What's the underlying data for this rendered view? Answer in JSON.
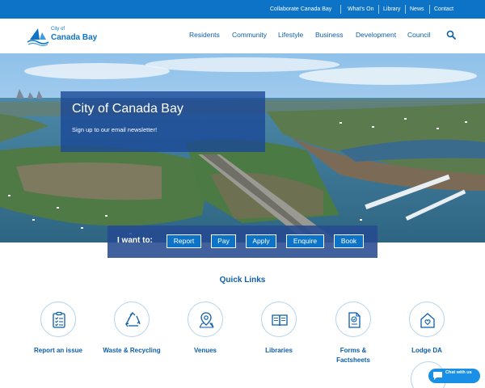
{
  "utility_nav": {
    "items": [
      {
        "label": "Collaborate Canada Bay"
      },
      {
        "label": "What's On"
      },
      {
        "label": "Library"
      },
      {
        "label": "News"
      },
      {
        "label": "Contact"
      }
    ]
  },
  "header": {
    "logo": {
      "line1": "City of",
      "line2": "Canada Bay",
      "icon": "boat-wave-logo-icon"
    },
    "nav": [
      {
        "label": "Residents"
      },
      {
        "label": "Community"
      },
      {
        "label": "Lifestyle"
      },
      {
        "label": "Business"
      },
      {
        "label": "Development"
      },
      {
        "label": "Council"
      }
    ],
    "search_icon": "search-icon"
  },
  "hero": {
    "title": "City of Canada Bay",
    "newsletter_link": "Sign up to our email newsletter!"
  },
  "want_to": {
    "label": "I want to:",
    "buttons": [
      {
        "label": "Report"
      },
      {
        "label": "Pay"
      },
      {
        "label": "Apply"
      },
      {
        "label": "Enquire"
      },
      {
        "label": "Book"
      }
    ]
  },
  "quick_links": {
    "heading": "Quick Links",
    "items": [
      {
        "label": "Report an issue",
        "icon": "clipboard-checklist-icon"
      },
      {
        "label": "Waste & Recycling",
        "icon": "recycle-icon"
      },
      {
        "label": "Venues",
        "icon": "map-pin-icon"
      },
      {
        "label": "Libraries",
        "icon": "open-book-icon"
      },
      {
        "label": "Forms & Factsheets",
        "icon": "form-document-icon"
      },
      {
        "label": "Lodge DA",
        "icon": "house-heart-icon"
      }
    ]
  },
  "chat": {
    "label": "Chat with us",
    "icon": "chat-bubble-icon"
  },
  "colors": {
    "brand_blue": "#0c73c7",
    "text_blue": "#0d5ea8",
    "panel_blue": "#19469a"
  }
}
